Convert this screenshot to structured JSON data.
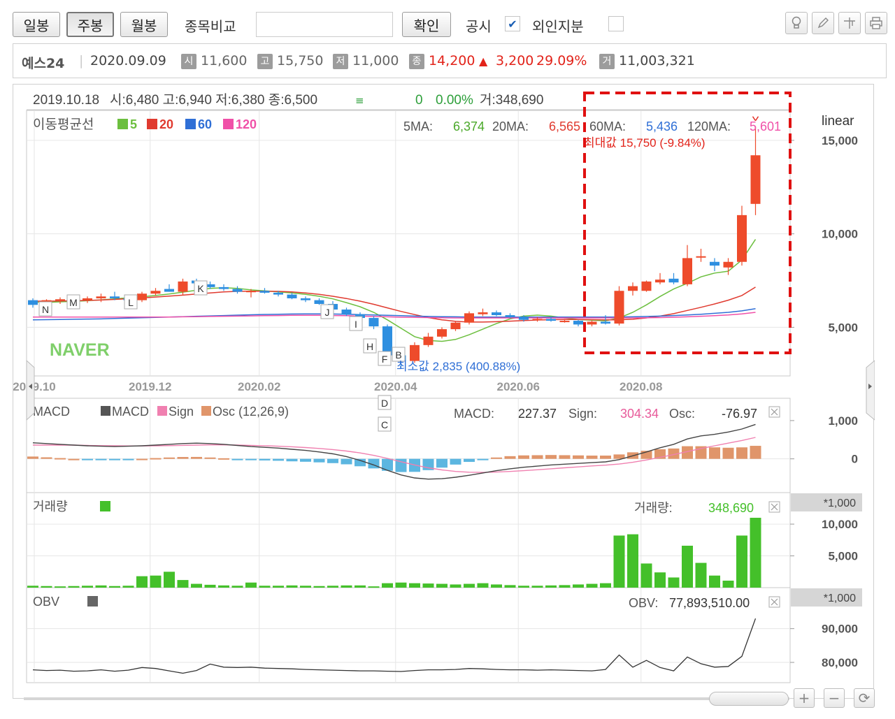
{
  "toolbar": {
    "period_buttons": [
      "일봉",
      "주봉",
      "월봉"
    ],
    "active_period": "주봉",
    "compare_label": "종목비교",
    "compare_input_value": "",
    "confirm_button": "확인",
    "disclosure_label": "공시",
    "disclosure_checked": true,
    "foreign_label": "외인지분",
    "foreign_checked": false,
    "tool_icons": [
      "lightbulb-icon",
      "pencil-icon",
      "crosshair-icon",
      "print-icon"
    ]
  },
  "info": {
    "name": "예스24",
    "date": "2020.09.09",
    "open_label": "시",
    "open": "11,600",
    "high_label": "고",
    "high": "15,750",
    "low_label": "저",
    "low": "11,000",
    "close_label": "종",
    "close": "14,200",
    "change_arrow": "▲",
    "change": "3,200",
    "change_pct": "29.09%",
    "volume_label": "거",
    "volume": "11,003,321",
    "up_color": "#e2231a"
  },
  "chart_header": {
    "date": "2019.10.18",
    "ohlc": "시:6,480 고:6,940 저:6,380 종:6,500",
    "change": "0",
    "change_pct": "0.00%",
    "volume": "거:348,690"
  },
  "ma_legend": {
    "title": "이동평균선",
    "items": [
      {
        "label": "5",
        "color": "#6cbf3f"
      },
      {
        "label": "20",
        "color": "#e03a2f"
      },
      {
        "label": "60",
        "color": "#2f6fd6"
      },
      {
        "label": "120",
        "color": "#f050a8"
      }
    ],
    "values": [
      {
        "label": "5MA:",
        "value": "6,374",
        "color": "#4aa829"
      },
      {
        "label": "20MA:",
        "value": "6,565",
        "color": "#e03a2f"
      },
      {
        "label": "60MA:",
        "value": "5,436",
        "color": "#2f6fd6"
      },
      {
        "label": "120MA:",
        "value": "5,601",
        "color": "#f050a8"
      }
    ]
  },
  "scale_label": "linear",
  "watermark": "NAVER",
  "annotations": {
    "max_label": "최대값 15,750 (-9.84%)",
    "min_label": "최소값 2,835 (400.88%)",
    "markers": [
      "N",
      "M",
      "L",
      "K",
      "J",
      "I",
      "H",
      "F",
      "B",
      "D",
      "C"
    ]
  },
  "macd_panel": {
    "title": "MACD",
    "legend": [
      {
        "label": "MACD",
        "color": "#555555"
      },
      {
        "label": "Sign",
        "color": "#f080b0"
      },
      {
        "label": "Osc (12,26,9)",
        "color": "#e0956a"
      }
    ],
    "osc_neg_color": "#5cb6e0",
    "values": [
      {
        "label": "MACD:",
        "value": "227.37",
        "color": "#333333"
      },
      {
        "label": "Sign:",
        "value": "304.34",
        "color": "#e85a9a"
      },
      {
        "label": "Osc:",
        "value": "-76.97",
        "color": "#333333"
      }
    ],
    "y_ticks": [
      "1,000",
      "0"
    ]
  },
  "volume_panel": {
    "title": "거래량",
    "color": "#44c02a",
    "value_label": "거래량:",
    "value": "348,690",
    "unit": "*1,000",
    "y_ticks": [
      "10,000",
      "5,000"
    ]
  },
  "obv_panel": {
    "title": "OBV",
    "value_label": "OBV:",
    "value": "77,893,510.00",
    "unit": "*1,000",
    "y_ticks": [
      "90,000",
      "80,000"
    ]
  },
  "chart_data": {
    "type": "candlestick",
    "interval": "weekly",
    "x_ticks": [
      "2019.10",
      "2019.12",
      "2020.02",
      "2020.04",
      "2020.06",
      "2020.08"
    ],
    "y_ticks": [
      15000,
      10000,
      5000
    ],
    "ylim": [
      2400,
      16600
    ],
    "scale": "linear",
    "up_color": "#ee4b2b",
    "down_color": "#2e8fe0",
    "candles": [
      {
        "o": 6450,
        "h": 6550,
        "l": 6050,
        "c": 6200
      },
      {
        "o": 6200,
        "h": 6500,
        "l": 6050,
        "c": 6450
      },
      {
        "o": 6450,
        "h": 6600,
        "l": 6250,
        "c": 6500
      },
      {
        "o": 6500,
        "h": 6750,
        "l": 6300,
        "c": 6450
      },
      {
        "o": 6450,
        "h": 6650,
        "l": 6300,
        "c": 6550
      },
      {
        "o": 6550,
        "h": 6800,
        "l": 6350,
        "c": 6650
      },
      {
        "o": 6650,
        "h": 6900,
        "l": 6450,
        "c": 6550
      },
      {
        "o": 6550,
        "h": 6700,
        "l": 6250,
        "c": 6450
      },
      {
        "o": 6450,
        "h": 6900,
        "l": 6350,
        "c": 6800
      },
      {
        "o": 6800,
        "h": 7100,
        "l": 6700,
        "c": 6950
      },
      {
        "o": 7050,
        "h": 7300,
        "l": 6900,
        "c": 6900
      },
      {
        "o": 6900,
        "h": 7600,
        "l": 6700,
        "c": 7450
      },
      {
        "o": 7500,
        "h": 7600,
        "l": 7300,
        "c": 7350
      },
      {
        "o": 7300,
        "h": 7450,
        "l": 7050,
        "c": 7150
      },
      {
        "o": 7150,
        "h": 7300,
        "l": 6950,
        "c": 7050
      },
      {
        "o": 7050,
        "h": 7200,
        "l": 6800,
        "c": 6900
      },
      {
        "o": 6900,
        "h": 7050,
        "l": 6600,
        "c": 6950
      },
      {
        "o": 6950,
        "h": 7100,
        "l": 6800,
        "c": 6850
      },
      {
        "o": 6850,
        "h": 6950,
        "l": 6650,
        "c": 6750
      },
      {
        "o": 6750,
        "h": 6850,
        "l": 6500,
        "c": 6550
      },
      {
        "o": 6550,
        "h": 6650,
        "l": 6350,
        "c": 6450
      },
      {
        "o": 6450,
        "h": 6550,
        "l": 6200,
        "c": 6250
      },
      {
        "o": 6250,
        "h": 6400,
        "l": 5900,
        "c": 5950
      },
      {
        "o": 5950,
        "h": 6050,
        "l": 5600,
        "c": 5700
      },
      {
        "o": 5700,
        "h": 5800,
        "l": 5300,
        "c": 5500
      },
      {
        "o": 5500,
        "h": 5600,
        "l": 4900,
        "c": 5050
      },
      {
        "o": 5050,
        "h": 5150,
        "l": 3200,
        "c": 3500
      },
      {
        "o": 3500,
        "h": 3900,
        "l": 2835,
        "c": 3200
      },
      {
        "o": 3200,
        "h": 4200,
        "l": 3100,
        "c": 4050
      },
      {
        "o": 4050,
        "h": 4700,
        "l": 3950,
        "c": 4500
      },
      {
        "o": 4500,
        "h": 5000,
        "l": 4400,
        "c": 4900
      },
      {
        "o": 4900,
        "h": 5300,
        "l": 4800,
        "c": 5250
      },
      {
        "o": 5250,
        "h": 5850,
        "l": 5150,
        "c": 5750
      },
      {
        "o": 5700,
        "h": 6000,
        "l": 5600,
        "c": 5800
      },
      {
        "o": 5800,
        "h": 5900,
        "l": 5600,
        "c": 5650
      },
      {
        "o": 5650,
        "h": 5750,
        "l": 5500,
        "c": 5550
      },
      {
        "o": 5550,
        "h": 5650,
        "l": 5300,
        "c": 5400
      },
      {
        "o": 5400,
        "h": 5550,
        "l": 5300,
        "c": 5450
      },
      {
        "o": 5450,
        "h": 5550,
        "l": 5300,
        "c": 5350
      },
      {
        "o": 5350,
        "h": 5450,
        "l": 5250,
        "c": 5350
      },
      {
        "o": 5350,
        "h": 5400,
        "l": 5050,
        "c": 5150
      },
      {
        "o": 5150,
        "h": 5350,
        "l": 5050,
        "c": 5300
      },
      {
        "o": 5300,
        "h": 5650,
        "l": 5150,
        "c": 5200
      },
      {
        "o": 5200,
        "h": 7200,
        "l": 5100,
        "c": 6950
      },
      {
        "o": 6950,
        "h": 7400,
        "l": 6700,
        "c": 7200
      },
      {
        "o": 6950,
        "h": 7500,
        "l": 6900,
        "c": 7450
      },
      {
        "o": 7400,
        "h": 7900,
        "l": 7300,
        "c": 7550
      },
      {
        "o": 7600,
        "h": 7900,
        "l": 7300,
        "c": 7400
      },
      {
        "o": 7300,
        "h": 9400,
        "l": 7200,
        "c": 8700
      },
      {
        "o": 8750,
        "h": 9200,
        "l": 8500,
        "c": 8800
      },
      {
        "o": 8500,
        "h": 8700,
        "l": 8000,
        "c": 8300
      },
      {
        "o": 8200,
        "h": 8700,
        "l": 7800,
        "c": 8500
      },
      {
        "o": 8500,
        "h": 11500,
        "l": 8300,
        "c": 11000
      },
      {
        "o": 11600,
        "h": 15750,
        "l": 11000,
        "c": 14200
      }
    ],
    "ma_series": [
      {
        "name": "5MA",
        "color": "#6cbf3f",
        "values": [
          6350,
          6330,
          6360,
          6390,
          6420,
          6470,
          6520,
          6580,
          6630,
          6700,
          6780,
          6880,
          6980,
          7080,
          7120,
          7080,
          7000,
          6950,
          6900,
          6840,
          6760,
          6660,
          6520,
          6320,
          6100,
          5800,
          5400,
          4950,
          4500,
          4300,
          4250,
          4350,
          4600,
          4900,
          5200,
          5450,
          5600,
          5650,
          5600,
          5500,
          5420,
          5380,
          5350,
          5500,
          5800,
          6200,
          6650,
          7050,
          7350,
          7700,
          7900,
          8000,
          8600,
          9700
        ]
      },
      {
        "name": "20MA",
        "color": "#e03a2f",
        "values": [
          6400,
          6400,
          6410,
          6420,
          6440,
          6460,
          6490,
          6530,
          6570,
          6620,
          6670,
          6720,
          6780,
          6840,
          6890,
          6920,
          6930,
          6930,
          6920,
          6890,
          6840,
          6760,
          6660,
          6540,
          6400,
          6230,
          6040,
          5850,
          5680,
          5520,
          5400,
          5320,
          5280,
          5280,
          5300,
          5330,
          5360,
          5390,
          5410,
          5420,
          5420,
          5410,
          5400,
          5400,
          5430,
          5500,
          5600,
          5730,
          5900,
          6070,
          6250,
          6450,
          6700,
          7150
        ]
      },
      {
        "name": "60MA",
        "color": "#2f6fd6",
        "values": [
          5400,
          5410,
          5420,
          5430,
          5440,
          5450,
          5470,
          5490,
          5510,
          5530,
          5550,
          5570,
          5590,
          5610,
          5630,
          5650,
          5670,
          5690,
          5700,
          5710,
          5720,
          5720,
          5710,
          5700,
          5680,
          5660,
          5640,
          5620,
          5600,
          5580,
          5570,
          5560,
          5550,
          5550,
          5550,
          5550,
          5550,
          5550,
          5550,
          5550,
          5550,
          5550,
          5550,
          5550,
          5560,
          5580,
          5600,
          5630,
          5660,
          5700,
          5750,
          5800,
          5880,
          6000
        ]
      },
      {
        "name": "120MA",
        "color": "#f050a8",
        "values": [
          5550,
          5550,
          5550,
          5550,
          5550,
          5550,
          5550,
          5550,
          5550,
          5550,
          5550,
          5560,
          5570,
          5580,
          5590,
          5600,
          5610,
          5620,
          5630,
          5640,
          5640,
          5640,
          5630,
          5620,
          5600,
          5580,
          5560,
          5540,
          5530,
          5520,
          5510,
          5500,
          5500,
          5500,
          5500,
          5500,
          5500,
          5500,
          5500,
          5500,
          5500,
          5500,
          5500,
          5500,
          5500,
          5510,
          5520,
          5540,
          5560,
          5590,
          5620,
          5660,
          5720,
          5800
        ]
      }
    ],
    "macd": {
      "ylim": [
        -700,
        1400
      ],
      "macd": [
        420,
        400,
        380,
        360,
        340,
        330,
        320,
        330,
        340,
        360,
        380,
        400,
        410,
        400,
        380,
        350,
        320,
        300,
        280,
        250,
        220,
        180,
        130,
        60,
        -40,
        -160,
        -300,
        -420,
        -500,
        -530,
        -520,
        -480,
        -430,
        -370,
        -310,
        -260,
        -220,
        -190,
        -160,
        -140,
        -120,
        -100,
        -80,
        -20,
        80,
        180,
        290,
        380,
        520,
        600,
        640,
        700,
        780,
        900
      ],
      "sign": [
        360,
        360,
        360,
        360,
        350,
        345,
        340,
        338,
        338,
        340,
        345,
        352,
        360,
        365,
        365,
        360,
        352,
        342,
        330,
        315,
        296,
        272,
        242,
        203,
        154,
        90,
        12,
        -75,
        -160,
        -235,
        -290,
        -330,
        -350,
        -355,
        -345,
        -330,
        -310,
        -285,
        -260,
        -235,
        -210,
        -185,
        -165,
        -135,
        -90,
        -30,
        40,
        110,
        190,
        270,
        340,
        410,
        480,
        560
      ],
      "osc": [
        60,
        40,
        20,
        0,
        -10,
        -15,
        -20,
        -8,
        2,
        20,
        35,
        48,
        50,
        35,
        15,
        -10,
        -32,
        -42,
        -50,
        -65,
        -76,
        -92,
        -112,
        -143,
        -194,
        -250,
        -312,
        -345,
        -340,
        -295,
        -230,
        -150,
        -80,
        -15,
        35,
        70,
        90,
        95,
        100,
        95,
        90,
        85,
        85,
        115,
        170,
        210,
        250,
        270,
        330,
        330,
        300,
        290,
        300,
        340
      ]
    },
    "volume": {
      "unit": "*1,000",
      "ylim": [
        0,
        11000
      ],
      "values": [
        300,
        250,
        200,
        250,
        300,
        350,
        250,
        300,
        1800,
        1900,
        2500,
        1200,
        600,
        450,
        350,
        300,
        800,
        300,
        300,
        350,
        300,
        250,
        300,
        350,
        350,
        200,
        700,
        800,
        700,
        650,
        600,
        500,
        600,
        700,
        500,
        400,
        300,
        300,
        350,
        400,
        500,
        600,
        700,
        8200,
        8400,
        3800,
        2400,
        1600,
        6600,
        3900,
        1900,
        1100,
        8200,
        11000
      ]
    },
    "obv": {
      "unit": "*1,000",
      "ylim": [
        74000,
        98000
      ],
      "values": [
        77800,
        77600,
        77700,
        77400,
        77500,
        77800,
        77400,
        77700,
        78500,
        78200,
        77500,
        76800,
        77600,
        79500,
        78600,
        78500,
        78600,
        78300,
        78200,
        78100,
        77900,
        77800,
        77700,
        77600,
        77500,
        77500,
        77400,
        77300,
        77600,
        77800,
        77800,
        77900,
        78200,
        78100,
        77900,
        77800,
        77800,
        77700,
        77800,
        77700,
        77600,
        77500,
        77900,
        82200,
        78600,
        80600,
        78500,
        77500,
        81600,
        79600,
        78600,
        78800,
        81800,
        93000
      ]
    }
  }
}
